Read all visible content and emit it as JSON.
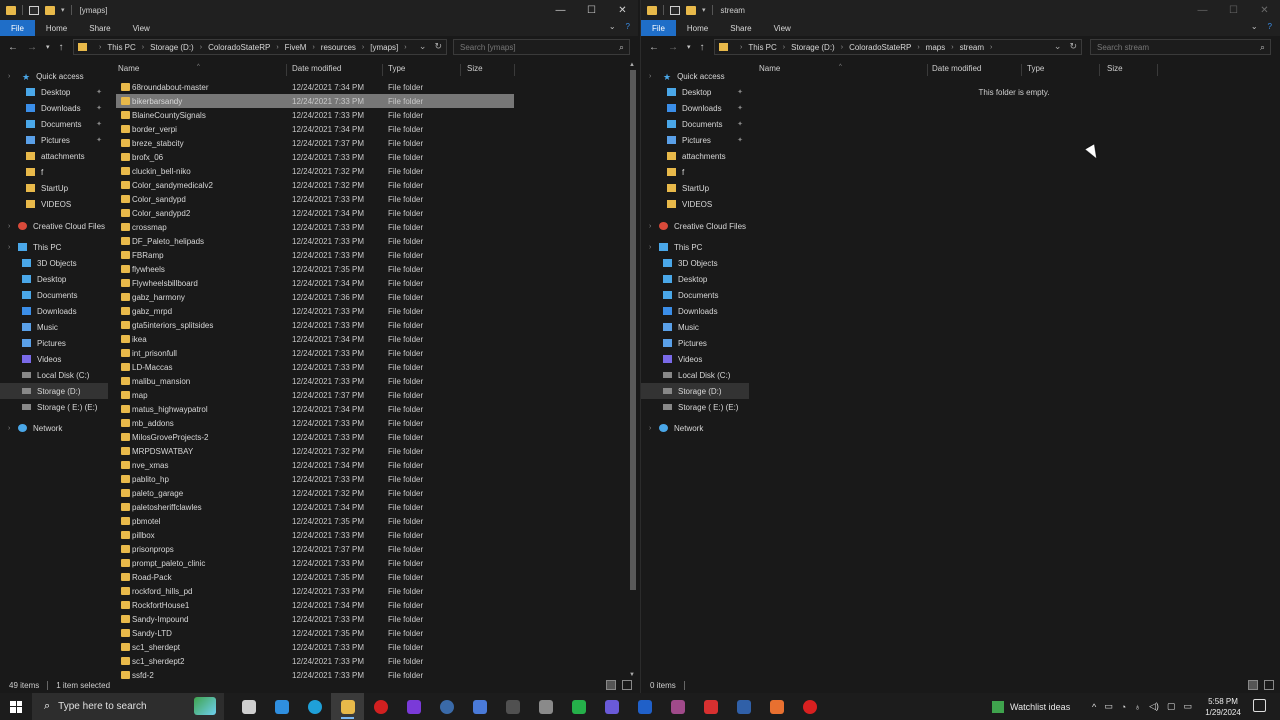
{
  "left": {
    "title": "[ymaps]",
    "tabs": [
      "File",
      "Home",
      "Share",
      "View"
    ],
    "breadcrumb": [
      "This PC",
      "Storage (D:)",
      "ColoradoStateRP",
      "FiveM",
      "resources",
      "[ymaps]"
    ],
    "search_placeholder": "Search [ymaps]",
    "columns": [
      "Name",
      "Date modified",
      "Type",
      "Size"
    ],
    "files": [
      {
        "name": "68roundabout-master",
        "date": "12/24/2021 7:34 PM",
        "type": "File folder"
      },
      {
        "name": "bikerbarsandy",
        "date": "12/24/2021 7:33 PM",
        "type": "File folder"
      },
      {
        "name": "BlaineCountySignals",
        "date": "12/24/2021 7:33 PM",
        "type": "File folder"
      },
      {
        "name": "border_verpi",
        "date": "12/24/2021 7:34 PM",
        "type": "File folder"
      },
      {
        "name": "breze_stabcity",
        "date": "12/24/2021 7:37 PM",
        "type": "File folder"
      },
      {
        "name": "brofx_06",
        "date": "12/24/2021 7:33 PM",
        "type": "File folder"
      },
      {
        "name": "cluckin_bell-niko",
        "date": "12/24/2021 7:32 PM",
        "type": "File folder"
      },
      {
        "name": "Color_sandymedicalv2",
        "date": "12/24/2021 7:32 PM",
        "type": "File folder"
      },
      {
        "name": "Color_sandypd",
        "date": "12/24/2021 7:33 PM",
        "type": "File folder"
      },
      {
        "name": "Color_sandypd2",
        "date": "12/24/2021 7:34 PM",
        "type": "File folder"
      },
      {
        "name": "crossmap",
        "date": "12/24/2021 7:33 PM",
        "type": "File folder"
      },
      {
        "name": "DF_Paleto_helipads",
        "date": "12/24/2021 7:33 PM",
        "type": "File folder"
      },
      {
        "name": "FBRamp",
        "date": "12/24/2021 7:33 PM",
        "type": "File folder"
      },
      {
        "name": "flywheels",
        "date": "12/24/2021 7:35 PM",
        "type": "File folder"
      },
      {
        "name": "Flywheelsbillboard",
        "date": "12/24/2021 7:34 PM",
        "type": "File folder"
      },
      {
        "name": "gabz_harmony",
        "date": "12/24/2021 7:36 PM",
        "type": "File folder"
      },
      {
        "name": "gabz_mrpd",
        "date": "12/24/2021 7:33 PM",
        "type": "File folder"
      },
      {
        "name": "gta5interiors_splitsides",
        "date": "12/24/2021 7:33 PM",
        "type": "File folder"
      },
      {
        "name": "ikea",
        "date": "12/24/2021 7:34 PM",
        "type": "File folder"
      },
      {
        "name": "int_prisonfull",
        "date": "12/24/2021 7:33 PM",
        "type": "File folder"
      },
      {
        "name": "LD-Maccas",
        "date": "12/24/2021 7:33 PM",
        "type": "File folder"
      },
      {
        "name": "malibu_mansion",
        "date": "12/24/2021 7:33 PM",
        "type": "File folder"
      },
      {
        "name": "map",
        "date": "12/24/2021 7:37 PM",
        "type": "File folder"
      },
      {
        "name": "matus_highwaypatrol",
        "date": "12/24/2021 7:34 PM",
        "type": "File folder"
      },
      {
        "name": "mb_addons",
        "date": "12/24/2021 7:33 PM",
        "type": "File folder"
      },
      {
        "name": "MilosGroveProjects-2",
        "date": "12/24/2021 7:33 PM",
        "type": "File folder"
      },
      {
        "name": "MRPDSWATBAY",
        "date": "12/24/2021 7:32 PM",
        "type": "File folder"
      },
      {
        "name": "nve_xmas",
        "date": "12/24/2021 7:34 PM",
        "type": "File folder"
      },
      {
        "name": "pablito_hp",
        "date": "12/24/2021 7:33 PM",
        "type": "File folder"
      },
      {
        "name": "paleto_garage",
        "date": "12/24/2021 7:32 PM",
        "type": "File folder"
      },
      {
        "name": "paletosheriffclawles",
        "date": "12/24/2021 7:34 PM",
        "type": "File folder"
      },
      {
        "name": "pbmotel",
        "date": "12/24/2021 7:35 PM",
        "type": "File folder"
      },
      {
        "name": "pillbox",
        "date": "12/24/2021 7:33 PM",
        "type": "File folder"
      },
      {
        "name": "prisonprops",
        "date": "12/24/2021 7:37 PM",
        "type": "File folder"
      },
      {
        "name": "prompt_paleto_clinic",
        "date": "12/24/2021 7:33 PM",
        "type": "File folder"
      },
      {
        "name": "Road-Pack",
        "date": "12/24/2021 7:35 PM",
        "type": "File folder"
      },
      {
        "name": "rockford_hills_pd",
        "date": "12/24/2021 7:33 PM",
        "type": "File folder"
      },
      {
        "name": "RockfortHouse1",
        "date": "12/24/2021 7:34 PM",
        "type": "File folder"
      },
      {
        "name": "Sandy-Impound",
        "date": "12/24/2021 7:33 PM",
        "type": "File folder"
      },
      {
        "name": "Sandy-LTD",
        "date": "12/24/2021 7:35 PM",
        "type": "File folder"
      },
      {
        "name": "sc1_sherdept",
        "date": "12/24/2021 7:33 PM",
        "type": "File folder"
      },
      {
        "name": "sc1_sherdept2",
        "date": "12/24/2021 7:33 PM",
        "type": "File folder"
      },
      {
        "name": "ssfd-2",
        "date": "12/24/2021 7:33 PM",
        "type": "File folder"
      }
    ],
    "selected_index": 1,
    "status_items": "49 items",
    "status_selected": "1 item selected"
  },
  "right": {
    "title": "stream",
    "tabs": [
      "File",
      "Home",
      "Share",
      "View"
    ],
    "breadcrumb": [
      "This PC",
      "Storage (D:)",
      "ColoradoStateRP",
      "maps",
      "stream"
    ],
    "search_placeholder": "Search stream",
    "columns": [
      "Name",
      "Date modified",
      "Type",
      "Size"
    ],
    "empty_message": "This folder is empty.",
    "status_items": "0 items"
  },
  "nav": [
    {
      "label": "Quick access",
      "icon": "star-icon",
      "kind": "i-star",
      "indent": 22,
      "pin": false,
      "gap": 0
    },
    {
      "label": "Desktop",
      "icon": "desktop-icon",
      "kind": "i-desk",
      "indent": 26,
      "pin": true,
      "gap": 0
    },
    {
      "label": "Downloads",
      "icon": "downloads-icon",
      "kind": "i-blue",
      "indent": 26,
      "pin": true,
      "gap": 0
    },
    {
      "label": "Documents",
      "icon": "documents-icon",
      "kind": "i-desk",
      "indent": 26,
      "pin": true,
      "gap": 0
    },
    {
      "label": "Pictures",
      "icon": "pictures-icon",
      "kind": "i-pics",
      "indent": 26,
      "pin": true,
      "gap": 0
    },
    {
      "label": "attachments",
      "icon": "folder-icon",
      "kind": "i-folder",
      "indent": 26,
      "pin": false,
      "gap": 0
    },
    {
      "label": "f",
      "icon": "folder-icon",
      "kind": "i-folder",
      "indent": 26,
      "pin": false,
      "gap": 0
    },
    {
      "label": "StartUp",
      "icon": "folder-icon",
      "kind": "i-folder",
      "indent": 26,
      "pin": false,
      "gap": 0
    },
    {
      "label": "VIDEOS",
      "icon": "folder-icon",
      "kind": "i-folder",
      "indent": 26,
      "pin": false,
      "gap": 0
    },
    {
      "label": "Creative Cloud Files",
      "icon": "creative-cloud-icon",
      "kind": "i-cc",
      "indent": 18,
      "pin": false,
      "gap": 6
    },
    {
      "label": "This PC",
      "icon": "this-pc-icon",
      "kind": "i-pc",
      "indent": 18,
      "pin": false,
      "gap": 5
    },
    {
      "label": "3D Objects",
      "icon": "3d-objects-icon",
      "kind": "i-desk",
      "indent": 22,
      "pin": false,
      "gap": 0
    },
    {
      "label": "Desktop",
      "icon": "desktop-icon",
      "kind": "i-desk",
      "indent": 22,
      "pin": false,
      "gap": 0
    },
    {
      "label": "Documents",
      "icon": "documents-icon",
      "kind": "i-desk",
      "indent": 22,
      "pin": false,
      "gap": 0
    },
    {
      "label": "Downloads",
      "icon": "downloads-icon",
      "kind": "i-blue",
      "indent": 22,
      "pin": false,
      "gap": 0
    },
    {
      "label": "Music",
      "icon": "music-icon",
      "kind": "i-music",
      "indent": 22,
      "pin": false,
      "gap": 0
    },
    {
      "label": "Pictures",
      "icon": "pictures-icon",
      "kind": "i-pics",
      "indent": 22,
      "pin": false,
      "gap": 0
    },
    {
      "label": "Videos",
      "icon": "videos-icon",
      "kind": "i-vid",
      "indent": 22,
      "pin": false,
      "gap": 0
    },
    {
      "label": "Local Disk (C:)",
      "icon": "drive-icon",
      "kind": "i-drive",
      "indent": 22,
      "pin": false,
      "gap": 0
    },
    {
      "label": "Storage (D:)",
      "icon": "drive-icon",
      "kind": "i-drive",
      "indent": 22,
      "pin": false,
      "gap": 0,
      "selected": true
    },
    {
      "label": "Storage ( E:) (E:)",
      "icon": "drive-icon",
      "kind": "i-drive",
      "indent": 22,
      "pin": false,
      "gap": 0
    },
    {
      "label": "Network",
      "icon": "network-icon",
      "kind": "i-net",
      "indent": 18,
      "pin": false,
      "gap": 5
    }
  ],
  "taskbar": {
    "search_placeholder": "Type here to search",
    "watchlist": "Watchlist ideas",
    "time": "5:58 PM",
    "date": "1/29/2024",
    "apps": [
      {
        "name": "task-view-icon",
        "color": "#cfcfcf"
      },
      {
        "name": "mail-icon",
        "color": "#2f8fe0"
      },
      {
        "name": "edge-icon",
        "color": "#1fa0d8"
      },
      {
        "name": "file-explorer-icon",
        "color": "#e8b94a"
      },
      {
        "name": "red-app-icon",
        "color": "#d22020"
      },
      {
        "name": "purple-app-icon",
        "color": "#7a3ad8"
      },
      {
        "name": "steam-icon",
        "color": "#3a6aa8"
      },
      {
        "name": "editor-icon",
        "color": "#4a7ad8"
      },
      {
        "name": "dark-app-icon",
        "color": "#505050"
      },
      {
        "name": "voice-app-icon",
        "color": "#8a8a8a"
      },
      {
        "name": "whatsapp-icon",
        "color": "#25b04a"
      },
      {
        "name": "obs-icon",
        "color": "#6a5ad8"
      },
      {
        "name": "blue-l-icon",
        "color": "#2060c8"
      },
      {
        "name": "archive-icon",
        "color": "#a04a8a"
      },
      {
        "name": "filezilla-icon",
        "color": "#d83030"
      },
      {
        "name": "blue-app-icon",
        "color": "#3060a8"
      },
      {
        "name": "orange-app-icon",
        "color": "#e87030"
      },
      {
        "name": "controller-icon",
        "color": "#d82020"
      }
    ]
  },
  "accent": "#1f6ec8",
  "folder_color": "#e8b94a"
}
